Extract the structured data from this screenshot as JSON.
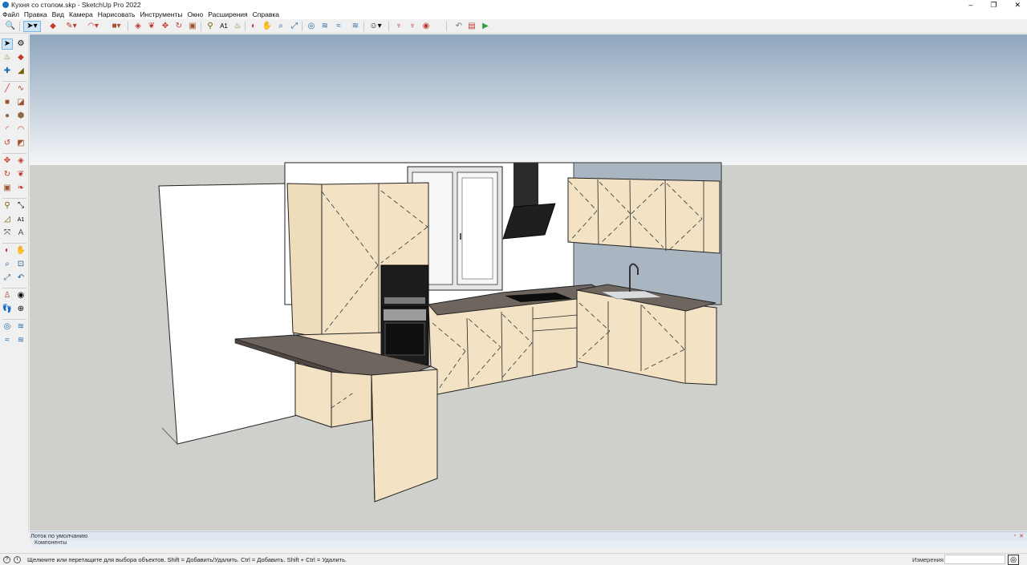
{
  "window": {
    "title": "Кухня со столом.skp - SketchUp Pro 2022",
    "minimize": "–",
    "maximize": "❐",
    "close": "✕"
  },
  "menu": [
    "Файл",
    "Правка",
    "Вид",
    "Камера",
    "Нарисовать",
    "Инструменты",
    "Окно",
    "Расширения",
    "Справка"
  ],
  "tray": {
    "title": "Лоток по умолчанию",
    "section": "Компоненты",
    "pin": "▫",
    "close": "✕"
  },
  "status": {
    "hint": "Щелкните или перетащите для выбора объектов. Shift = Добавить/Удалить. Ctrl = Добавить. Shift + Ctrl = Удалить.",
    "measure_label": "Измерения",
    "help_icon": "?",
    "info_icon": "i"
  },
  "colors": {
    "sky_top": "#8fa6bd",
    "sky_bottom": "#f3f5f7",
    "ground": "#cfcfcb",
    "cabinet": "#f3e2c3",
    "countertop": "#6e655e",
    "wall_blue": "#a9b6c2",
    "hood": "#2b2b2b",
    "oven": "#1c1c1c"
  }
}
